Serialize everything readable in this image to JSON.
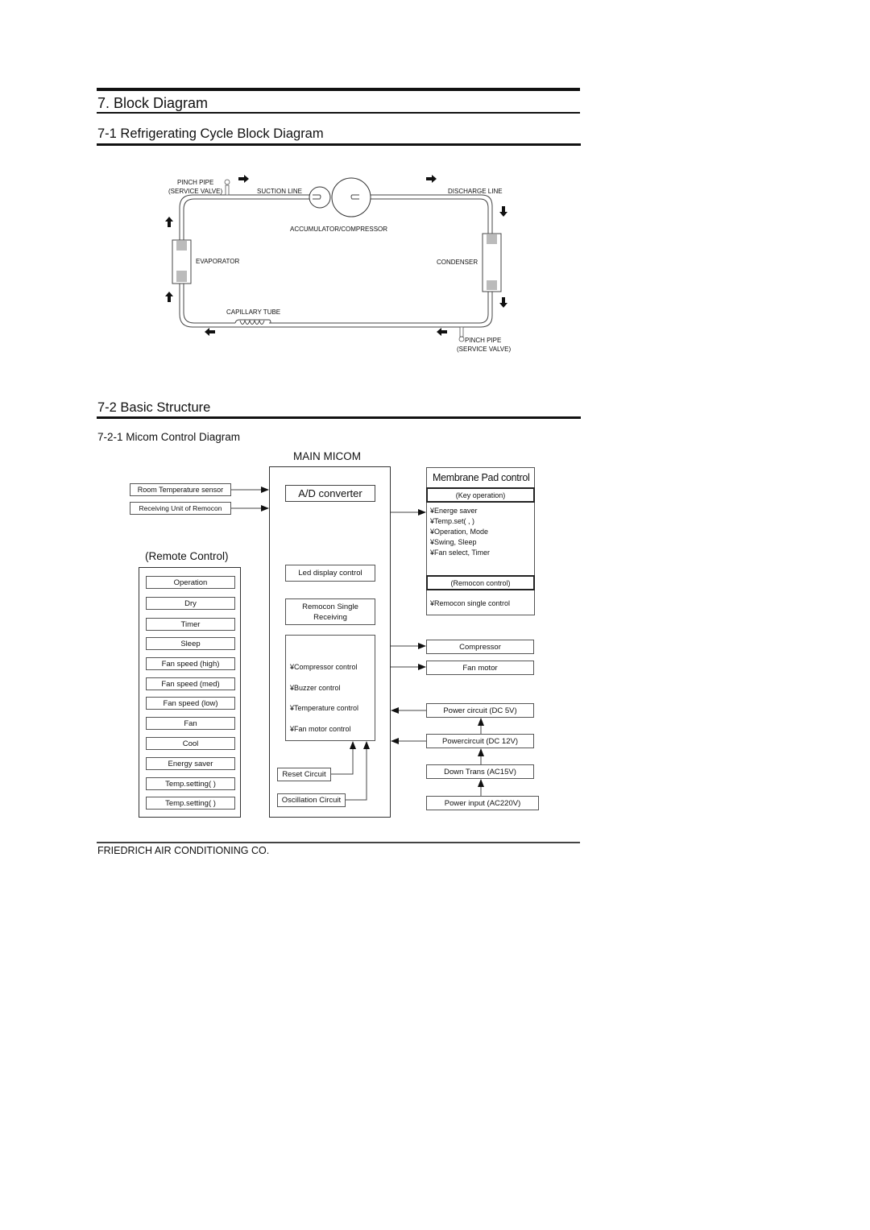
{
  "page": {
    "title": "7. Block Diagram",
    "section1_title": "7-1 Refrigerating Cycle Block Diagram",
    "section2_title": "7-2 Basic Structure",
    "subsection_title": "7-2-1 Micom Control Diagram",
    "footer": "FRIEDRICH AIR CONDITIONING CO."
  },
  "cycle": {
    "pinch_pipe_top": [
      "PINCH PIPE",
      "(SERVICE VALVE)"
    ],
    "suction_line": "SUCTION LINE",
    "discharge_line": "DISCHARGE LINE",
    "accumulator_compressor": "ACCUMULATOR/COMPRESSOR",
    "evaporator": "EVAPORATOR",
    "condenser": "CONDENSER",
    "capillary_tube": "CAPILLARY TUBE",
    "pinch_pipe_bottom": [
      "PINCH PIPE",
      "(SERVICE VALVE)"
    ]
  },
  "micom": {
    "main_title": "MAIN MICOM",
    "inputs": [
      "Room Temperature sensor",
      "Receiving Unit of Remocon"
    ],
    "ad_converter": "A/D converter",
    "led_display": "Led display control",
    "remocon_single_receiving": [
      "Remocon Single",
      "Receiving"
    ],
    "control_list": [
      "¥Compressor control",
      "¥Buzzer control",
      "¥Temperature control",
      "¥Fan motor control"
    ],
    "reset_circuit": "Reset Circuit",
    "oscillation_circuit": "Oscillation Circuit"
  },
  "remote": {
    "title": "(Remote Control)",
    "buttons": [
      "Operation",
      "Dry",
      "Timer",
      "Sleep",
      "Fan speed (high)",
      "Fan speed (med)",
      "Fan speed (low)",
      "Fan",
      "Cool",
      "Energy saver",
      "Temp.setting(  )",
      "Temp.setting(  )"
    ]
  },
  "membrane": {
    "title": "Membrane Pad control",
    "key_operation": "(Key operation)",
    "key_items": [
      "¥Energe saver",
      "¥Temp.set(  ,   )",
      "¥Operation, Mode",
      "¥Swing, Sleep",
      "¥Fan select, Timer"
    ],
    "remocon_control": "(Remocon control)",
    "remocon_items": [
      "¥Remocon single control"
    ]
  },
  "outputs": [
    "Compressor",
    "Fan motor"
  ],
  "power": [
    "Power circuit (DC 5V)",
    "Powercircuit (DC 12V)",
    "Down Trans (AC15V)",
    "Power input (AC220V)"
  ]
}
